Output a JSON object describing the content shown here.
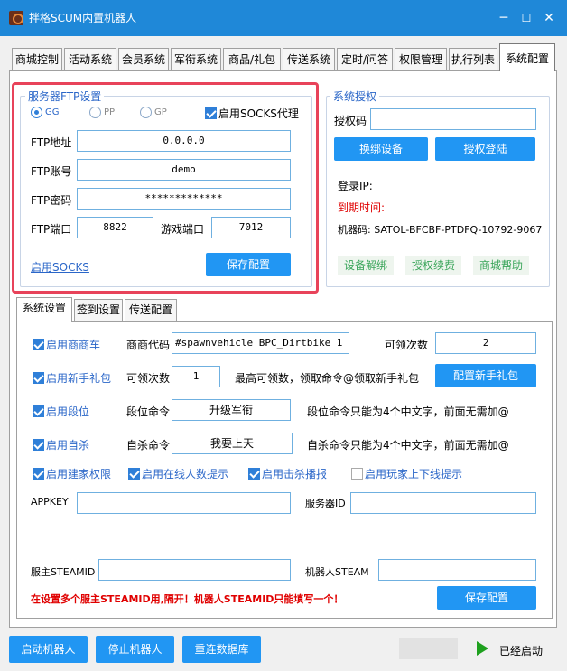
{
  "window": {
    "title": "拌格SCUM内置机器人",
    "minimize": "─",
    "maximize": "☐",
    "close": "✕"
  },
  "tabs": [
    "商城控制",
    "活动系统",
    "会员系统",
    "军衔系统",
    "商品/礼包",
    "传送系统",
    "定时/问答",
    "权限管理",
    "执行列表",
    "系统配置"
  ],
  "active_tab": "系统配置",
  "ftp": {
    "group_label": "服务器FTP设置",
    "radios": [
      {
        "label": "GG",
        "selected": true
      },
      {
        "label": "PP",
        "selected": false
      },
      {
        "label": "GP",
        "selected": false
      }
    ],
    "socks_checkbox_label": "启用SOCKS代理",
    "socks_checked": true,
    "addr_label": "FTP地址",
    "addr_value": "0.0.0.0",
    "account_label": "FTP账号",
    "account_value": "demo",
    "password_label": "FTP密码",
    "password_value": "*************",
    "port_label": "FTP端口",
    "port_value": "8822",
    "game_port_label": "游戏端口",
    "game_port_value": "7012",
    "socks_link": "启用SOCKS",
    "save_button": "保存配置"
  },
  "auth": {
    "group_label": "系统授权",
    "code_label": "授权码",
    "code_value": "",
    "change_device_button": "换绑设备",
    "login_button": "授权登陆",
    "login_ip_label": "登录IP:",
    "expire_label": "到期时间:",
    "machine_code": "机器码: SATOL-BFCBF-PTDFQ-10792-9067",
    "unbind_link": "设备解绑",
    "renew_link": "授权续费",
    "help_link": "商城帮助"
  },
  "subtabs": [
    "系统设置",
    "签到设置",
    "传送配置"
  ],
  "active_subtab": "系统设置",
  "settings": {
    "shop_car": {
      "label": "启用商商车",
      "checked": true,
      "code_label": "商商代码",
      "code_value": "#spawnvehicle BPC_Dirtbike  1",
      "count_label": "可领次数",
      "count_value": "2"
    },
    "newbie": {
      "label": "启用新手礼包",
      "checked": true,
      "count_label": "可领次数",
      "count_value": "1",
      "hint": "最高可领数，领取命令@领取新手礼包",
      "config_button": "配置新手礼包"
    },
    "rank": {
      "label": "启用段位",
      "checked": true,
      "cmd_label": "段位命令",
      "cmd_value": "升级军衔",
      "hint": "段位命令只能为4个中文字，前面无需加@"
    },
    "suicide": {
      "label": "启用自杀",
      "checked": true,
      "cmd_label": "自杀命令",
      "cmd_value": "我要上天",
      "hint": "自杀命令只能为4个中文字，前面无需加@"
    },
    "checks": [
      {
        "label": "启用建家权限",
        "checked": true
      },
      {
        "label": "启用在线人数提示",
        "checked": true
      },
      {
        "label": "启用击杀播报",
        "checked": true
      },
      {
        "label": "启用玩家上下线提示",
        "checked": false
      }
    ],
    "appkey_label": "APPKEY",
    "appkey_value": "",
    "server_id_label": "服务器ID",
    "server_id_value": "",
    "owner_steamid_label": "服主STEAMID",
    "owner_steamid_value": "",
    "bot_steam_label": "机器人STEAM",
    "bot_steam_value": "",
    "warning": "在设置多个服主STEAMID用,隔开！机器人STEAMID只能填写一个！",
    "save_button": "保存配置"
  },
  "bottom": {
    "start_button": "启动机器人",
    "stop_button": "停止机器人",
    "reconnect_button": "重连数据库",
    "status": "已经启动"
  },
  "colors": {
    "accent": "#2196f3",
    "title_bar": "#1f88d8",
    "highlight_border": "#e8435a",
    "warning": "#e00000",
    "link_green": "#3aa55a"
  }
}
